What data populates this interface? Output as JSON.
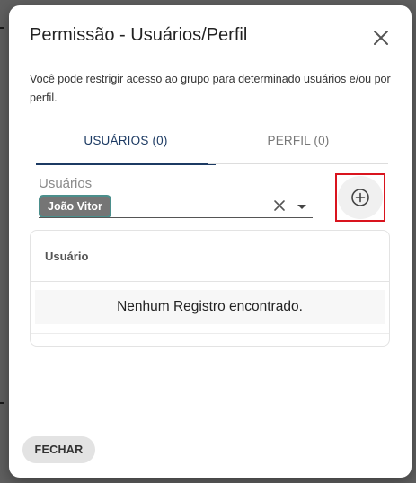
{
  "dialog": {
    "title": "Permissão - Usuários/Perfil",
    "description": "Você pode restrigir acesso ao grupo para determinado usuários e/ou por perfil.",
    "close_icon": "close-icon"
  },
  "tabs": [
    {
      "label": "USUÁRIOS (0)",
      "active": true
    },
    {
      "label": "PERFIL (0)",
      "active": false
    }
  ],
  "users_field": {
    "label": "Usuários",
    "selected_chip": "João Vitor",
    "clear_icon": "close-icon",
    "dropdown_icon": "caret-down-icon"
  },
  "add_button": {
    "icon": "add-circle-icon"
  },
  "table": {
    "column_header": "Usuário",
    "empty_message": "Nenhum Registro encontrado."
  },
  "footer": {
    "close_label": "FECHAR"
  },
  "colors": {
    "accent": "#1c3a63",
    "chip_bg": "#757575",
    "highlight": "#d9141e"
  }
}
